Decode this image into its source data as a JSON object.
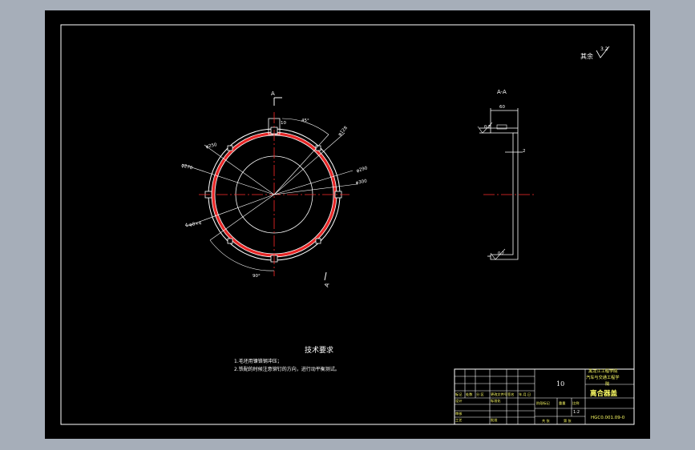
{
  "colors": {
    "background": "#a6aeb9",
    "sheet": "#000000",
    "line": "#ffffff",
    "center_line": "#ff2a2a",
    "hatch": "#ff2a2a",
    "title_text": "#ffff66"
  },
  "drawing": {
    "roughness": "其余",
    "roughness_value": "3.2",
    "section_mark": "A",
    "section_title": "A-A",
    "dims": {
      "d_width": "60",
      "d_thickness": "2",
      "d_d1": "φ250",
      "d_d2": "φ270",
      "d_d3": "φ128",
      "d_d4": "φ290",
      "d_d5": "φ300",
      "d_holes": "4-φ8×4",
      "d_small": "10",
      "d_ang1": "45°",
      "d_ang2": "90°",
      "d_r1": "0.2",
      "d_r2": "0.2"
    }
  },
  "notes": {
    "title": "技术要求",
    "lines": [
      "1.毛坯用镍铬钢冲压；",
      "2.铁配的时候注意铆钉的方向，进行动平衡测试。"
    ]
  },
  "title_block": {
    "qty": "10",
    "school": "黑龙江工程学院汽车与交通工程学院",
    "part_name": "离合器盖",
    "drawing_no": "HGC0.001.09-0",
    "scale": "1:2",
    "labels": {
      "biaoji": "标记",
      "chushu": "处数",
      "fenqu": "分 区",
      "gengai": "更改文件号",
      "qianming": "签名",
      "nianyueri": "年.月.日",
      "sheji": "设计",
      "biaozhunhua": "标准化",
      "jieduan": "阶段标记",
      "zhongliang": "重量",
      "bili": "比例",
      "shenhe": "审核",
      "gongyi": "工艺",
      "pizhun": "批准",
      "gongzhang": "共 张",
      "dizhang": "第 张"
    }
  }
}
